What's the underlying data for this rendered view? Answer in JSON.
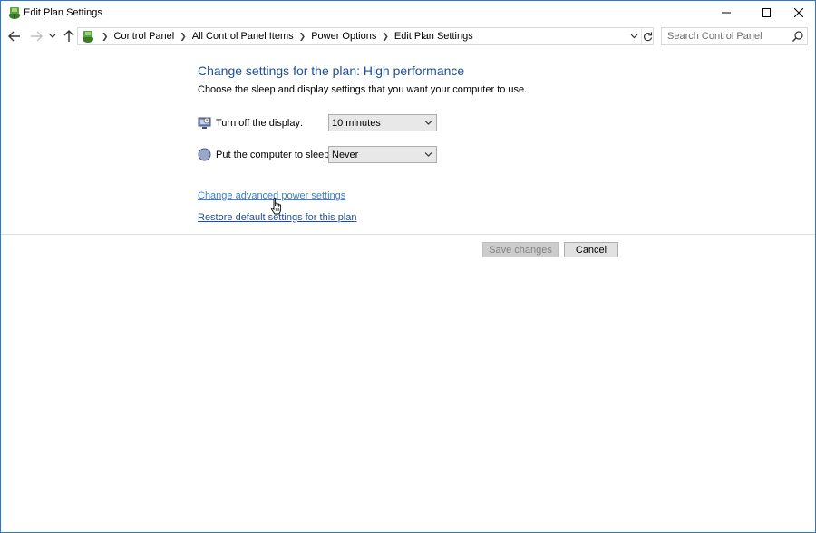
{
  "window": {
    "title": "Edit Plan Settings"
  },
  "address": {
    "crumbs": [
      "Control Panel",
      "All Control Panel Items",
      "Power Options",
      "Edit Plan Settings"
    ]
  },
  "search": {
    "placeholder": "Search Control Panel"
  },
  "main": {
    "heading": "Change settings for the plan: High performance",
    "subheading": "Choose the sleep and display settings that you want your computer to use.",
    "display_setting": {
      "label": "Turn off the display:",
      "value": "10 minutes"
    },
    "sleep_setting": {
      "label": "Put the computer to sleep:",
      "value": "Never"
    },
    "advanced_link": "Change advanced power settings",
    "restore_link": "Restore default settings for this plan"
  },
  "buttons": {
    "save_label": "Save changes",
    "cancel_label": "Cancel"
  },
  "colors": {
    "heading": "#1e4e9a",
    "link": "#1e4e9a",
    "link_hover": "#3c7fd3",
    "window_border": "#2b79c4"
  },
  "icons": {
    "app": "power-options-icon",
    "display": "monitor-icon",
    "sleep": "moon-icon",
    "search": "search-icon"
  }
}
